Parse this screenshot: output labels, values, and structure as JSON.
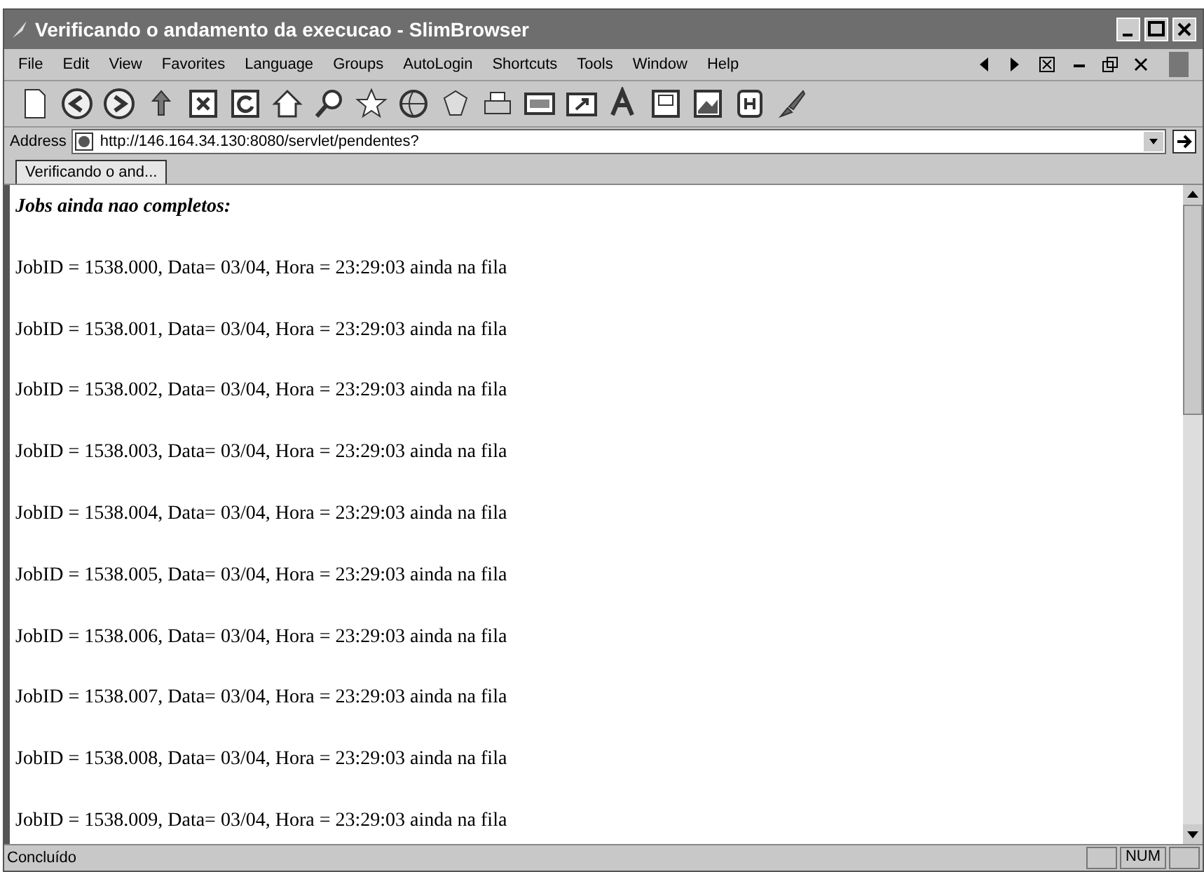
{
  "window": {
    "title": "Verificando o andamento da execucao - SlimBrowser"
  },
  "menu": [
    "File",
    "Edit",
    "View",
    "Favorites",
    "Language",
    "Groups",
    "AutoLogin",
    "Shortcuts",
    "Tools",
    "Window",
    "Help"
  ],
  "address": {
    "label": "Address",
    "value": "http://146.164.34.130:8080/servlet/pendentes?"
  },
  "tabs": [
    {
      "label": "Verificando o and...",
      "selected": true
    }
  ],
  "page": {
    "heading": "Jobs ainda nao completos:",
    "lines": [
      "JobID = 1538.000, Data= 03/04, Hora = 23:29:03 ainda na fila",
      "JobID = 1538.001, Data= 03/04, Hora = 23:29:03 ainda na fila",
      "JobID = 1538.002, Data= 03/04, Hora = 23:29:03 ainda na fila",
      "JobID = 1538.003, Data= 03/04, Hora = 23:29:03 ainda na fila",
      "JobID = 1538.004, Data= 03/04, Hora = 23:29:03 ainda na fila",
      "JobID = 1538.005, Data= 03/04, Hora = 23:29:03 ainda na fila",
      "JobID = 1538.006, Data= 03/04, Hora = 23:29:03 ainda na fila",
      "JobID = 1538.007, Data= 03/04, Hora = 23:29:03 ainda na fila",
      "JobID = 1538.008, Data= 03/04, Hora = 23:29:03 ainda na fila",
      "JobID = 1538.009, Data= 03/04, Hora = 23:29:03 ainda na fila"
    ]
  },
  "status_bar": {
    "text": "Concluído",
    "indicator": "NUM"
  }
}
